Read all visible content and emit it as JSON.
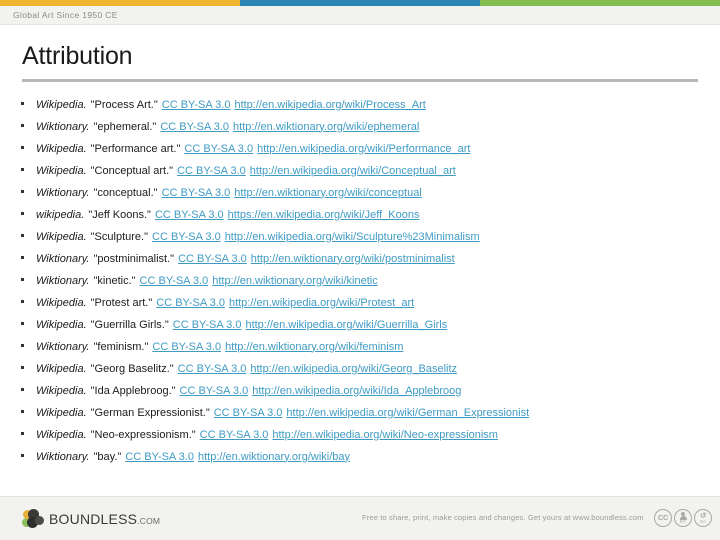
{
  "header": {
    "kicker": "Global Art Since 1950 CE",
    "bands": [
      {
        "name": "yellow",
        "color": "#f0b52e"
      },
      {
        "name": "blue",
        "color": "#2b86b4"
      },
      {
        "name": "green",
        "color": "#84bd4f"
      }
    ]
  },
  "page": {
    "title": "Attribution"
  },
  "attributions": [
    {
      "source": "Wikipedia.",
      "term": "\"Process Art.\"",
      "license": "CC BY-SA 3.0",
      "url": "http://en.wikipedia.org/wiki/Process_Art"
    },
    {
      "source": "Wiktionary.",
      "term": "\"ephemeral.\"",
      "license": "CC BY-SA 3.0",
      "url": "http://en.wiktionary.org/wiki/ephemeral"
    },
    {
      "source": "Wikipedia.",
      "term": "\"Performance art.\"",
      "license": "CC BY-SA 3.0",
      "url": "http://en.wikipedia.org/wiki/Performance_art"
    },
    {
      "source": "Wikipedia.",
      "term": "\"Conceptual art.\"",
      "license": "CC BY-SA 3.0",
      "url": "http://en.wikipedia.org/wiki/Conceptual_art"
    },
    {
      "source": "Wiktionary.",
      "term": "\"conceptual.\"",
      "license": "CC BY-SA 3.0",
      "url": "http://en.wiktionary.org/wiki/conceptual"
    },
    {
      "source": "wikipedia.",
      "term": "\"Jeff Koons.\"",
      "license": "CC BY-SA 3.0",
      "url": "https://en.wikipedia.org/wiki/Jeff_Koons"
    },
    {
      "source": "Wikipedia.",
      "term": "\"Sculpture.\"",
      "license": "CC BY-SA 3.0",
      "url": "http://en.wikipedia.org/wiki/Sculpture%23Minimalism"
    },
    {
      "source": "Wiktionary.",
      "term": "\"postminimalist.\"",
      "license": "CC BY-SA 3.0",
      "url": "http://en.wiktionary.org/wiki/postminimalist"
    },
    {
      "source": "Wiktionary.",
      "term": "\"kinetic.\"",
      "license": "CC BY-SA 3.0",
      "url": "http://en.wiktionary.org/wiki/kinetic"
    },
    {
      "source": "Wikipedia.",
      "term": "\"Protest art.\"",
      "license": "CC BY-SA 3.0",
      "url": "http://en.wikipedia.org/wiki/Protest_art"
    },
    {
      "source": "Wikipedia.",
      "term": "\"Guerrilla Girls.\"",
      "license": "CC BY-SA 3.0",
      "url": "http://en.wikipedia.org/wiki/Guerrilla_Girls"
    },
    {
      "source": "Wiktionary.",
      "term": "\"feminism.\"",
      "license": "CC BY-SA 3.0",
      "url": "http://en.wiktionary.org/wiki/feminism"
    },
    {
      "source": "Wikipedia.",
      "term": "\"Georg Baselitz.\"",
      "license": "CC BY-SA 3.0",
      "url": "http://en.wikipedia.org/wiki/Georg_Baselitz"
    },
    {
      "source": "Wikipedia.",
      "term": "\"Ida Applebroog.\"",
      "license": "CC BY-SA 3.0",
      "url": "http://en.wikipedia.org/wiki/Ida_Applebroog"
    },
    {
      "source": "Wikipedia.",
      "term": "\"German Expressionist.\"",
      "license": "CC BY-SA 3.0",
      "url": "http://en.wikipedia.org/wiki/German_Expressionist"
    },
    {
      "source": "Wikipedia.",
      "term": "\"Neo-expressionism.\"",
      "license": "CC BY-SA 3.0",
      "url": "http://en.wikipedia.org/wiki/Neo-expressionism"
    },
    {
      "source": "Wiktionary.",
      "term": "\"bay.\"",
      "license": "CC BY-SA 3.0",
      "url": "http://en.wiktionary.org/wiki/bay"
    }
  ],
  "footer": {
    "brand_name": "BOUNDLESS",
    "brand_tld": ".COM",
    "note": "Free to share, print, make copies and changes. Get yours at www.boundless.com",
    "cc_badges": [
      {
        "glyph": "CC",
        "caption": ""
      },
      {
        "glyph": "person",
        "caption": "BY"
      },
      {
        "glyph": "↺",
        "caption": "SA"
      }
    ]
  },
  "colors": {
    "link": "#3f9bc4",
    "rule": "#b8b8b8",
    "chrome": "#f2f2f0"
  }
}
